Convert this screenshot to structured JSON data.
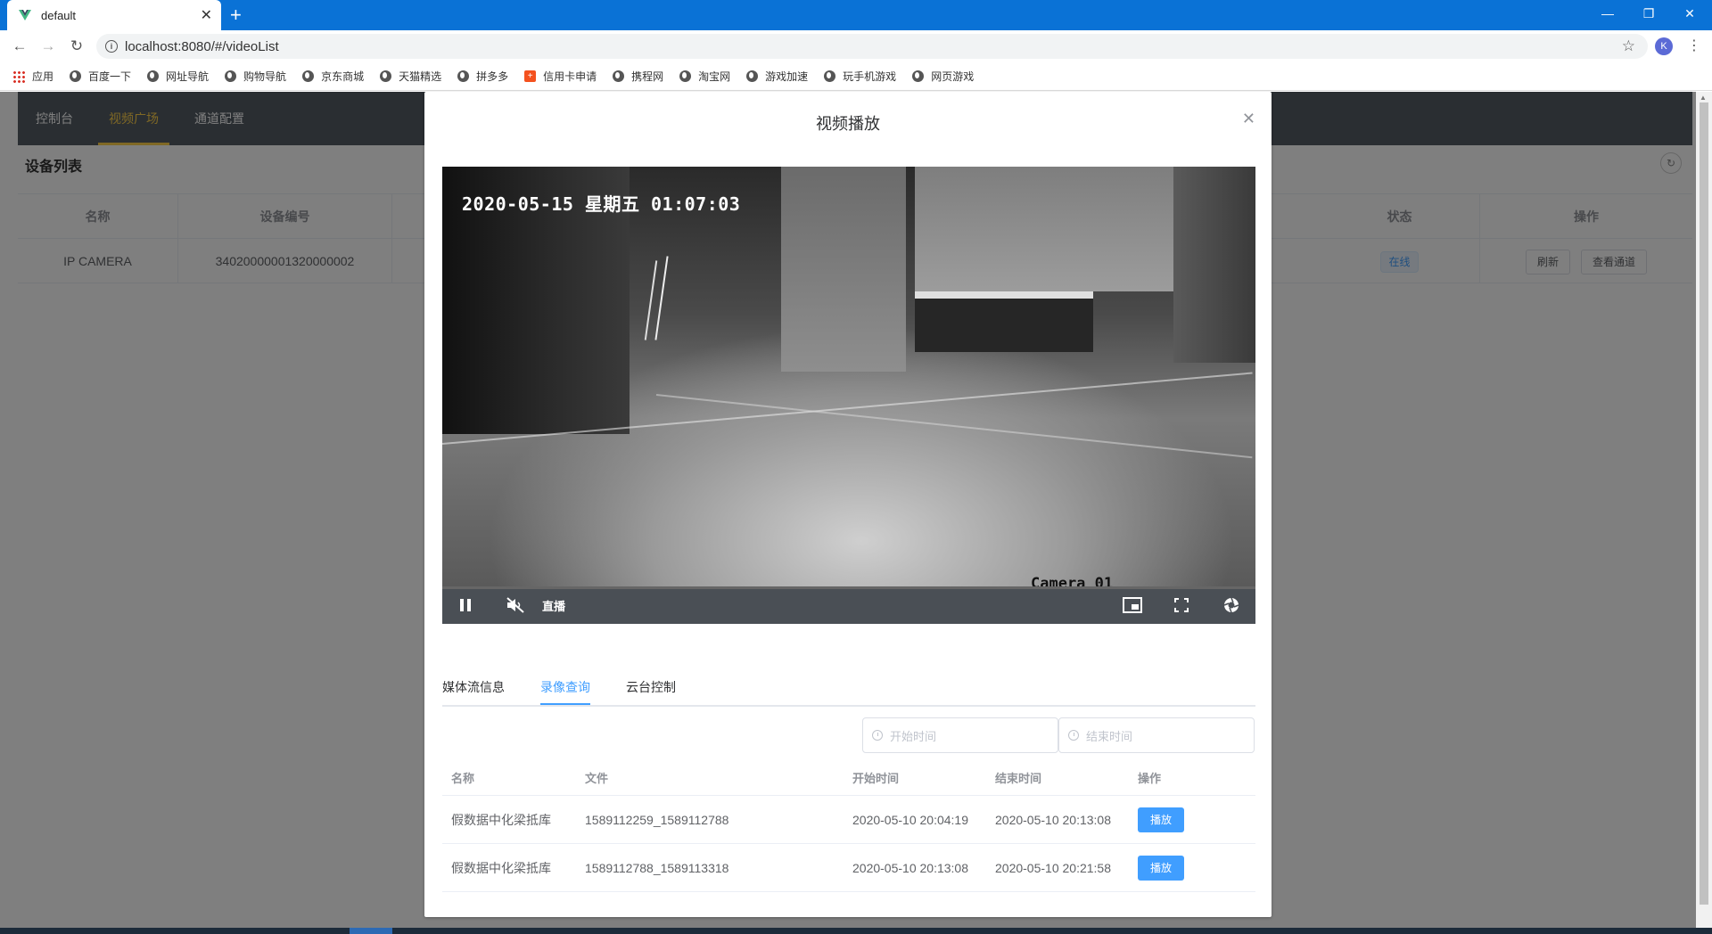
{
  "browser": {
    "tab_title": "default",
    "url": "localhost:8080/#/videoList",
    "profile_initial": "K",
    "bookmarks": [
      "应用",
      "百度一下",
      "网址导航",
      "购物导航",
      "京东商城",
      "天猫精选",
      "拼多多",
      "信用卡申请",
      "携程网",
      "淘宝网",
      "游戏加速",
      "玩手机游戏",
      "网页游戏"
    ]
  },
  "nav": {
    "items": [
      "控制台",
      "视频广场",
      "通道配置"
    ],
    "active_index": 1
  },
  "device_list": {
    "title": "设备列表",
    "columns": [
      "名称",
      "设备编号",
      "状态",
      "操作"
    ],
    "rows": [
      {
        "name": "IP CAMERA",
        "device_id": "34020000001320000002",
        "status": "在线",
        "actions": [
          "刷新",
          "查看通道"
        ]
      }
    ]
  },
  "dialog": {
    "title": "视频播放",
    "player": {
      "osd_timestamp": "2020-05-15 星期五 01:07:03",
      "camera_label": "Camera 01",
      "live_label": "直播"
    },
    "tabs": [
      "媒体流信息",
      "录像查询",
      "云台控制"
    ],
    "active_tab": 1,
    "start_placeholder": "开始时间",
    "end_placeholder": "结束时间",
    "records": {
      "columns": [
        "名称",
        "文件",
        "开始时间",
        "结束时间",
        "操作"
      ],
      "rows": [
        {
          "name": "假数据中化梁抵库",
          "file": "1589112259_1589112788",
          "start": "2020-05-10 20:04:19",
          "end": "2020-05-10 20:13:08",
          "action": "播放"
        },
        {
          "name": "假数据中化梁抵库",
          "file": "1589112788_1589113318",
          "start": "2020-05-10 20:13:08",
          "end": "2020-05-10 20:21:58",
          "action": "播放"
        }
      ]
    }
  },
  "colors": {
    "chrome_blue": "#0a72d6",
    "nav_bg": "#545c64",
    "nav_active": "#ffd04b",
    "primary": "#409eff"
  }
}
